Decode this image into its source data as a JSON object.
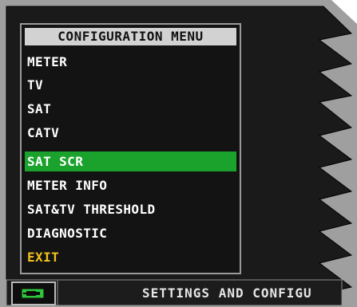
{
  "menu": {
    "title": "CONFIGURATION MENU",
    "items": [
      {
        "label": "METER"
      },
      {
        "label": "TV"
      },
      {
        "label": "SAT"
      },
      {
        "label": "CATV"
      },
      {
        "label": "SAT SCR"
      },
      {
        "label": "METER INFO"
      },
      {
        "label": "SAT&TV THRESHOLD"
      },
      {
        "label": "DIAGNOSTIC"
      },
      {
        "label": "EXIT"
      }
    ],
    "selected_label": "SAT SCR"
  },
  "status_bar": {
    "text": "SETTINGS AND CONFIGU",
    "battery_icon": "plug-battery-icon"
  },
  "colors": {
    "selection": "#1aa22d",
    "exit": "#f2c21c",
    "panel": "#131313"
  }
}
